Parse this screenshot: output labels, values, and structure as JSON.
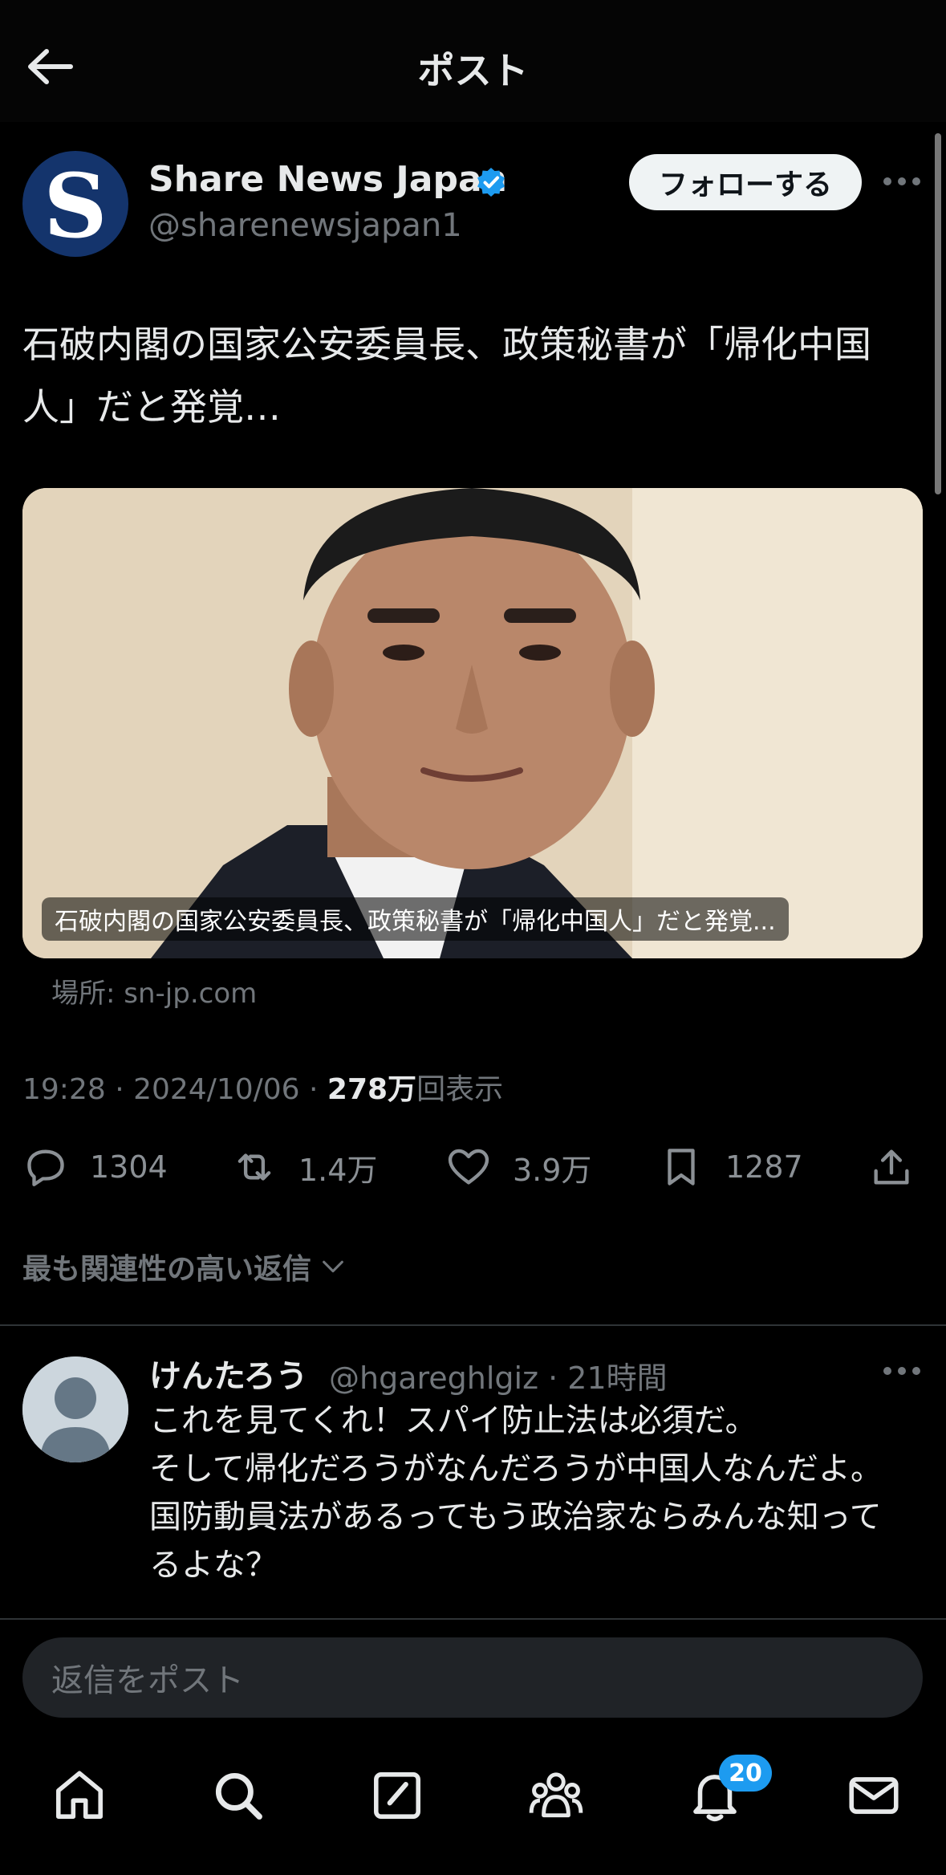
{
  "header": {
    "title": "ポスト",
    "back_icon": "arrow-left-icon"
  },
  "post": {
    "author": "Share News Japan",
    "avatar_letter": "S",
    "handle": "@sharenewsjapan1",
    "follow_label": "フォローする",
    "text": "石破内閣の国家公安委員長、政策秘書が「帰化中国人」だと発覚…",
    "card_caption": "石破内閣の国家公安委員長、政策秘書が「帰化中国人」だと発覚...",
    "source": "場所: sn-jp.com",
    "meta_prefix": "19:28 · 2024/10/06 · ",
    "views_value": "278万",
    "views_suffix": "回表示",
    "stats": {
      "replies": "1304",
      "reposts": "1.4万",
      "likes": "3.9万",
      "bookmarks": "1287"
    },
    "relevance_label": "最も関連性の高い返信"
  },
  "reply": {
    "name": "けんたろう",
    "handle_time": "@hgareghlgiz · 21時間",
    "text": "これを見てくれ！スパイ防止法は必須だ。\nそして帰化だろうがなんだろうが中国人なんだよ。\n国防動員法があるってもう政治家ならみんな知ってるよな？"
  },
  "composer": {
    "placeholder": "返信をポスト"
  },
  "tabbar": {
    "icons": [
      "home-icon",
      "search-icon",
      "compose-icon",
      "communities-icon",
      "notifications-icon",
      "messages-icon"
    ],
    "notification_badge": "20"
  },
  "colors": {
    "accent": "#1d9bf0",
    "muted": "#71767b",
    "text": "#e7e9ea"
  }
}
